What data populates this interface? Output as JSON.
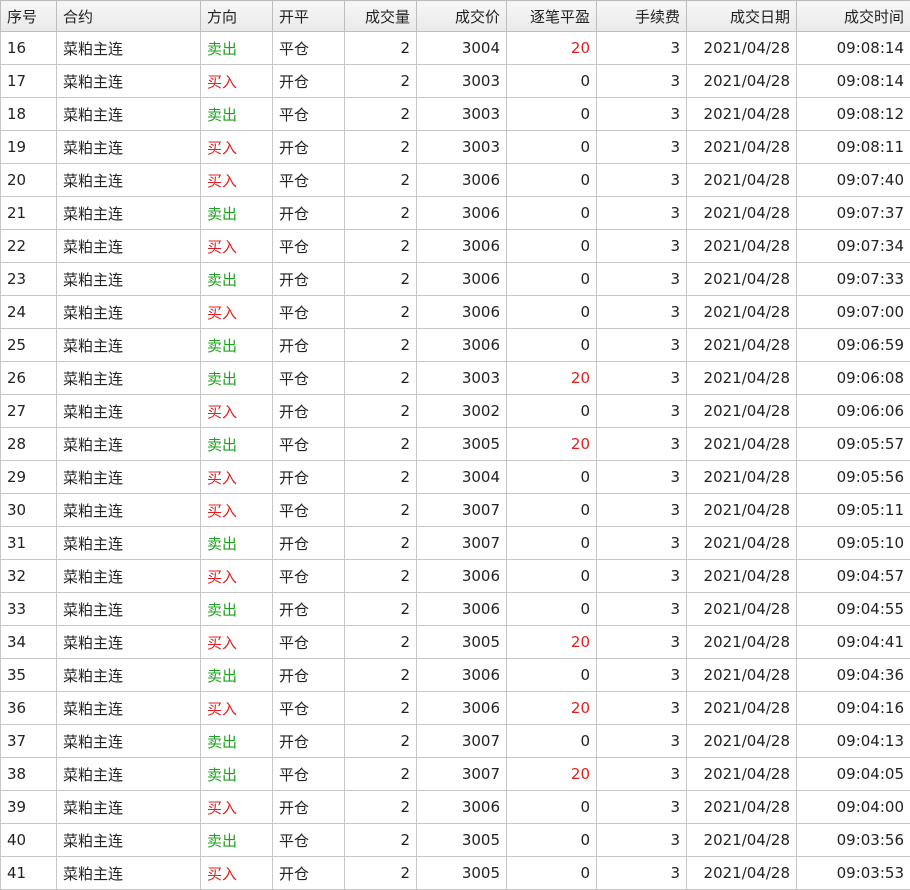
{
  "colors": {
    "buy": "#e02020",
    "sell": "#20a020",
    "profit": "#e02020"
  },
  "columns": [
    {
      "key": "seq",
      "label": "序号",
      "align": "left"
    },
    {
      "key": "contract",
      "label": "合约",
      "align": "left"
    },
    {
      "key": "direction",
      "label": "方向",
      "align": "left"
    },
    {
      "key": "openclose",
      "label": "开平",
      "align": "left"
    },
    {
      "key": "volume",
      "label": "成交量",
      "align": "right"
    },
    {
      "key": "price",
      "label": "成交价",
      "align": "right"
    },
    {
      "key": "pnl",
      "label": "逐笔平盈",
      "align": "right"
    },
    {
      "key": "fee",
      "label": "手续费",
      "align": "right"
    },
    {
      "key": "date",
      "label": "成交日期",
      "align": "right"
    },
    {
      "key": "time",
      "label": "成交时间",
      "align": "right"
    }
  ],
  "rows": [
    {
      "seq": "16",
      "contract": "菜粕主连",
      "direction": "卖出",
      "openclose": "平仓",
      "volume": "2",
      "price": "3004",
      "pnl": "20",
      "fee": "3",
      "date": "2021/04/28",
      "time": "09:08:14"
    },
    {
      "seq": "17",
      "contract": "菜粕主连",
      "direction": "买入",
      "openclose": "开仓",
      "volume": "2",
      "price": "3003",
      "pnl": "0",
      "fee": "3",
      "date": "2021/04/28",
      "time": "09:08:14"
    },
    {
      "seq": "18",
      "contract": "菜粕主连",
      "direction": "卖出",
      "openclose": "平仓",
      "volume": "2",
      "price": "3003",
      "pnl": "0",
      "fee": "3",
      "date": "2021/04/28",
      "time": "09:08:12"
    },
    {
      "seq": "19",
      "contract": "菜粕主连",
      "direction": "买入",
      "openclose": "开仓",
      "volume": "2",
      "price": "3003",
      "pnl": "0",
      "fee": "3",
      "date": "2021/04/28",
      "time": "09:08:11"
    },
    {
      "seq": "20",
      "contract": "菜粕主连",
      "direction": "买入",
      "openclose": "平仓",
      "volume": "2",
      "price": "3006",
      "pnl": "0",
      "fee": "3",
      "date": "2021/04/28",
      "time": "09:07:40"
    },
    {
      "seq": "21",
      "contract": "菜粕主连",
      "direction": "卖出",
      "openclose": "开仓",
      "volume": "2",
      "price": "3006",
      "pnl": "0",
      "fee": "3",
      "date": "2021/04/28",
      "time": "09:07:37"
    },
    {
      "seq": "22",
      "contract": "菜粕主连",
      "direction": "买入",
      "openclose": "平仓",
      "volume": "2",
      "price": "3006",
      "pnl": "0",
      "fee": "3",
      "date": "2021/04/28",
      "time": "09:07:34"
    },
    {
      "seq": "23",
      "contract": "菜粕主连",
      "direction": "卖出",
      "openclose": "开仓",
      "volume": "2",
      "price": "3006",
      "pnl": "0",
      "fee": "3",
      "date": "2021/04/28",
      "time": "09:07:33"
    },
    {
      "seq": "24",
      "contract": "菜粕主连",
      "direction": "买入",
      "openclose": "平仓",
      "volume": "2",
      "price": "3006",
      "pnl": "0",
      "fee": "3",
      "date": "2021/04/28",
      "time": "09:07:00"
    },
    {
      "seq": "25",
      "contract": "菜粕主连",
      "direction": "卖出",
      "openclose": "开仓",
      "volume": "2",
      "price": "3006",
      "pnl": "0",
      "fee": "3",
      "date": "2021/04/28",
      "time": "09:06:59"
    },
    {
      "seq": "26",
      "contract": "菜粕主连",
      "direction": "卖出",
      "openclose": "平仓",
      "volume": "2",
      "price": "3003",
      "pnl": "20",
      "fee": "3",
      "date": "2021/04/28",
      "time": "09:06:08"
    },
    {
      "seq": "27",
      "contract": "菜粕主连",
      "direction": "买入",
      "openclose": "开仓",
      "volume": "2",
      "price": "3002",
      "pnl": "0",
      "fee": "3",
      "date": "2021/04/28",
      "time": "09:06:06"
    },
    {
      "seq": "28",
      "contract": "菜粕主连",
      "direction": "卖出",
      "openclose": "平仓",
      "volume": "2",
      "price": "3005",
      "pnl": "20",
      "fee": "3",
      "date": "2021/04/28",
      "time": "09:05:57"
    },
    {
      "seq": "29",
      "contract": "菜粕主连",
      "direction": "买入",
      "openclose": "开仓",
      "volume": "2",
      "price": "3004",
      "pnl": "0",
      "fee": "3",
      "date": "2021/04/28",
      "time": "09:05:56"
    },
    {
      "seq": "30",
      "contract": "菜粕主连",
      "direction": "买入",
      "openclose": "平仓",
      "volume": "2",
      "price": "3007",
      "pnl": "0",
      "fee": "3",
      "date": "2021/04/28",
      "time": "09:05:11"
    },
    {
      "seq": "31",
      "contract": "菜粕主连",
      "direction": "卖出",
      "openclose": "开仓",
      "volume": "2",
      "price": "3007",
      "pnl": "0",
      "fee": "3",
      "date": "2021/04/28",
      "time": "09:05:10"
    },
    {
      "seq": "32",
      "contract": "菜粕主连",
      "direction": "买入",
      "openclose": "平仓",
      "volume": "2",
      "price": "3006",
      "pnl": "0",
      "fee": "3",
      "date": "2021/04/28",
      "time": "09:04:57"
    },
    {
      "seq": "33",
      "contract": "菜粕主连",
      "direction": "卖出",
      "openclose": "开仓",
      "volume": "2",
      "price": "3006",
      "pnl": "0",
      "fee": "3",
      "date": "2021/04/28",
      "time": "09:04:55"
    },
    {
      "seq": "34",
      "contract": "菜粕主连",
      "direction": "买入",
      "openclose": "平仓",
      "volume": "2",
      "price": "3005",
      "pnl": "20",
      "fee": "3",
      "date": "2021/04/28",
      "time": "09:04:41"
    },
    {
      "seq": "35",
      "contract": "菜粕主连",
      "direction": "卖出",
      "openclose": "开仓",
      "volume": "2",
      "price": "3006",
      "pnl": "0",
      "fee": "3",
      "date": "2021/04/28",
      "time": "09:04:36"
    },
    {
      "seq": "36",
      "contract": "菜粕主连",
      "direction": "买入",
      "openclose": "平仓",
      "volume": "2",
      "price": "3006",
      "pnl": "20",
      "fee": "3",
      "date": "2021/04/28",
      "time": "09:04:16"
    },
    {
      "seq": "37",
      "contract": "菜粕主连",
      "direction": "卖出",
      "openclose": "开仓",
      "volume": "2",
      "price": "3007",
      "pnl": "0",
      "fee": "3",
      "date": "2021/04/28",
      "time": "09:04:13"
    },
    {
      "seq": "38",
      "contract": "菜粕主连",
      "direction": "卖出",
      "openclose": "平仓",
      "volume": "2",
      "price": "3007",
      "pnl": "20",
      "fee": "3",
      "date": "2021/04/28",
      "time": "09:04:05"
    },
    {
      "seq": "39",
      "contract": "菜粕主连",
      "direction": "买入",
      "openclose": "开仓",
      "volume": "2",
      "price": "3006",
      "pnl": "0",
      "fee": "3",
      "date": "2021/04/28",
      "time": "09:04:00"
    },
    {
      "seq": "40",
      "contract": "菜粕主连",
      "direction": "卖出",
      "openclose": "平仓",
      "volume": "2",
      "price": "3005",
      "pnl": "0",
      "fee": "3",
      "date": "2021/04/28",
      "time": "09:03:56"
    },
    {
      "seq": "41",
      "contract": "菜粕主连",
      "direction": "买入",
      "openclose": "开仓",
      "volume": "2",
      "price": "3005",
      "pnl": "0",
      "fee": "3",
      "date": "2021/04/28",
      "time": "09:03:53"
    }
  ]
}
